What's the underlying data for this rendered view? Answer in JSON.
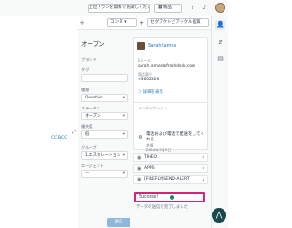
{
  "topbar": {
    "trial_label": "上位プランを無料でお試しください",
    "product_label": "製品",
    "product_icon": "grid-icon",
    "help_icon": "help-icon",
    "notifications_icon": "bell-icon"
  },
  "toolbar": {
    "contact_label": "コンタ",
    "plus_label": "+",
    "apps_label": "セグアクトビアックル画質"
  },
  "conversation": {
    "copy_link": "CC BCC"
  },
  "properties": {
    "status_title": "オープン",
    "field_1_label": "ブランド",
    "field_2_label": "タグ",
    "type_label": "種類",
    "type_value": "Question",
    "status_label": "ステータス",
    "status_value": "オープン",
    "priority_label": "優先度",
    "priority_value": "低",
    "group_label": "グループ",
    "group_value": "1.エスカレーション",
    "agent_label": "エージェント",
    "agent_value": "—",
    "submit_label": "送信"
  },
  "user_card": {
    "name": "Sarah James",
    "email_label": "Eメール",
    "email": "sarah.james@freshdesk.com",
    "phone_label": "電話番号",
    "phone": "+3602326",
    "notes_link": "詳細を表示",
    "interactions_label": "インタラクション",
    "ticket_title": "電話および電話で配送をしてくれる",
    "ticket_id": "#48",
    "ticket_date": "2024年3月9日",
    "ticket_status": "ステータス: オープン"
  },
  "apps": {
    "app_1": "TIHEO",
    "app_2": "APPS",
    "app_3": "[FIREFLY]SEND-ALERT",
    "highlight_text": "Success!",
    "under_text": "データの送信を完了しました"
  },
  "rail": {
    "user_icon": "user-icon",
    "zendesk_icon": "z-icon",
    "layout_icon": "layout-icon",
    "fab_icon": "assist-icon"
  }
}
